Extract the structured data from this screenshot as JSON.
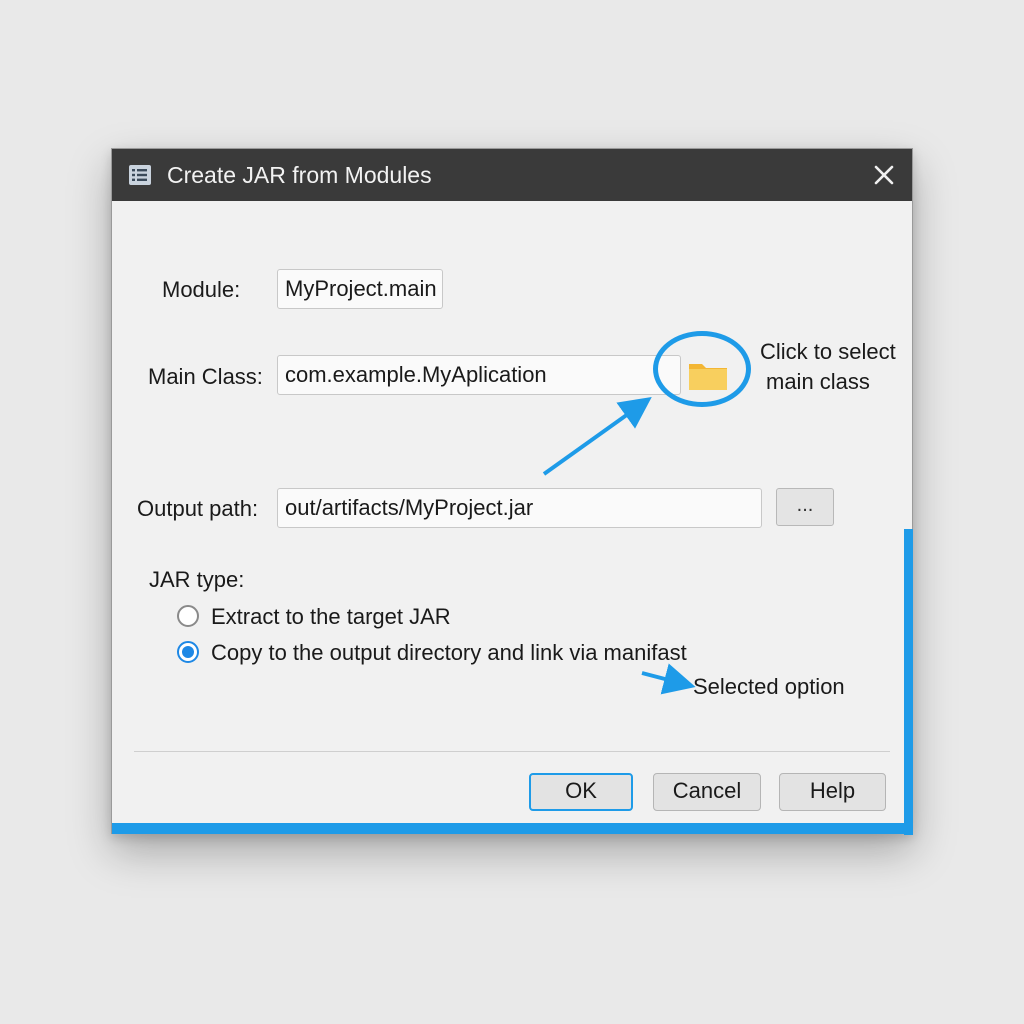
{
  "dialog": {
    "title": "Create JAR from Modules",
    "title_icon": "list-icon",
    "close_icon": "close-icon"
  },
  "module": {
    "label": "Module:",
    "value": "MyProject.main"
  },
  "main_class": {
    "label": "Main Class:",
    "value": "com.example.MyAplication",
    "browse_icon": "folder-icon",
    "callout_line1": "Click to select",
    "callout_line2": "main class"
  },
  "output_path": {
    "label": "Output path:",
    "value": "out/artifacts/MyProject.jar",
    "browse_label": "..."
  },
  "jar_type": {
    "label": "JAR type:",
    "options": [
      {
        "label": "Extract to the target JAR",
        "selected": false
      },
      {
        "label": "Copy to the output directory and link via manifast",
        "selected": true
      }
    ],
    "callout": "Selected option"
  },
  "buttons": {
    "ok": "OK",
    "cancel": "Cancel",
    "help": "Help"
  },
  "colors": {
    "accent": "#1e9be8",
    "titlebar": "#3a3a3a",
    "folder": "#f6c94b"
  }
}
